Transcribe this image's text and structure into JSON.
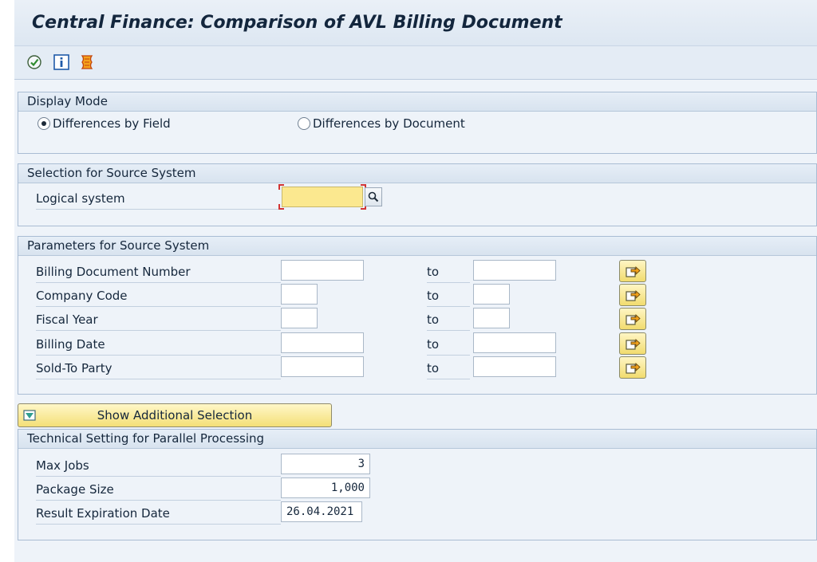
{
  "window": {
    "title": "Central Finance: Comparison of AVL Billing Document"
  },
  "toolbar": {
    "icons": [
      "execute-icon",
      "information-icon",
      "program-documentation-icon"
    ]
  },
  "display_mode": {
    "title": "Display Mode",
    "options": [
      {
        "label": "Differences by Field",
        "selected": true
      },
      {
        "label": "Differences by Document",
        "selected": false
      }
    ]
  },
  "source_system": {
    "title": "Selection for Source System",
    "logical_system": {
      "label": "Logical system",
      "value": ""
    }
  },
  "parameters": {
    "title": "Parameters for Source System",
    "to_label": "to",
    "rows": [
      {
        "label": "Billing Document Number",
        "from": "",
        "to": ""
      },
      {
        "label": "Company Code",
        "from": "",
        "to": ""
      },
      {
        "label": "Fiscal Year",
        "from": "",
        "to": ""
      },
      {
        "label": "Billing Date",
        "from": "",
        "to": ""
      },
      {
        "label": "Sold-To Party",
        "from": "",
        "to": ""
      }
    ]
  },
  "additional_selection": {
    "label": "Show Additional Selection"
  },
  "technical": {
    "title": "Technical Setting for Parallel Processing",
    "max_jobs": {
      "label": "Max Jobs",
      "value": "3"
    },
    "package_size": {
      "label": "Package Size",
      "value": "1,000"
    },
    "expiration": {
      "label": "Result Expiration Date",
      "value": "26.04.2021"
    }
  }
}
